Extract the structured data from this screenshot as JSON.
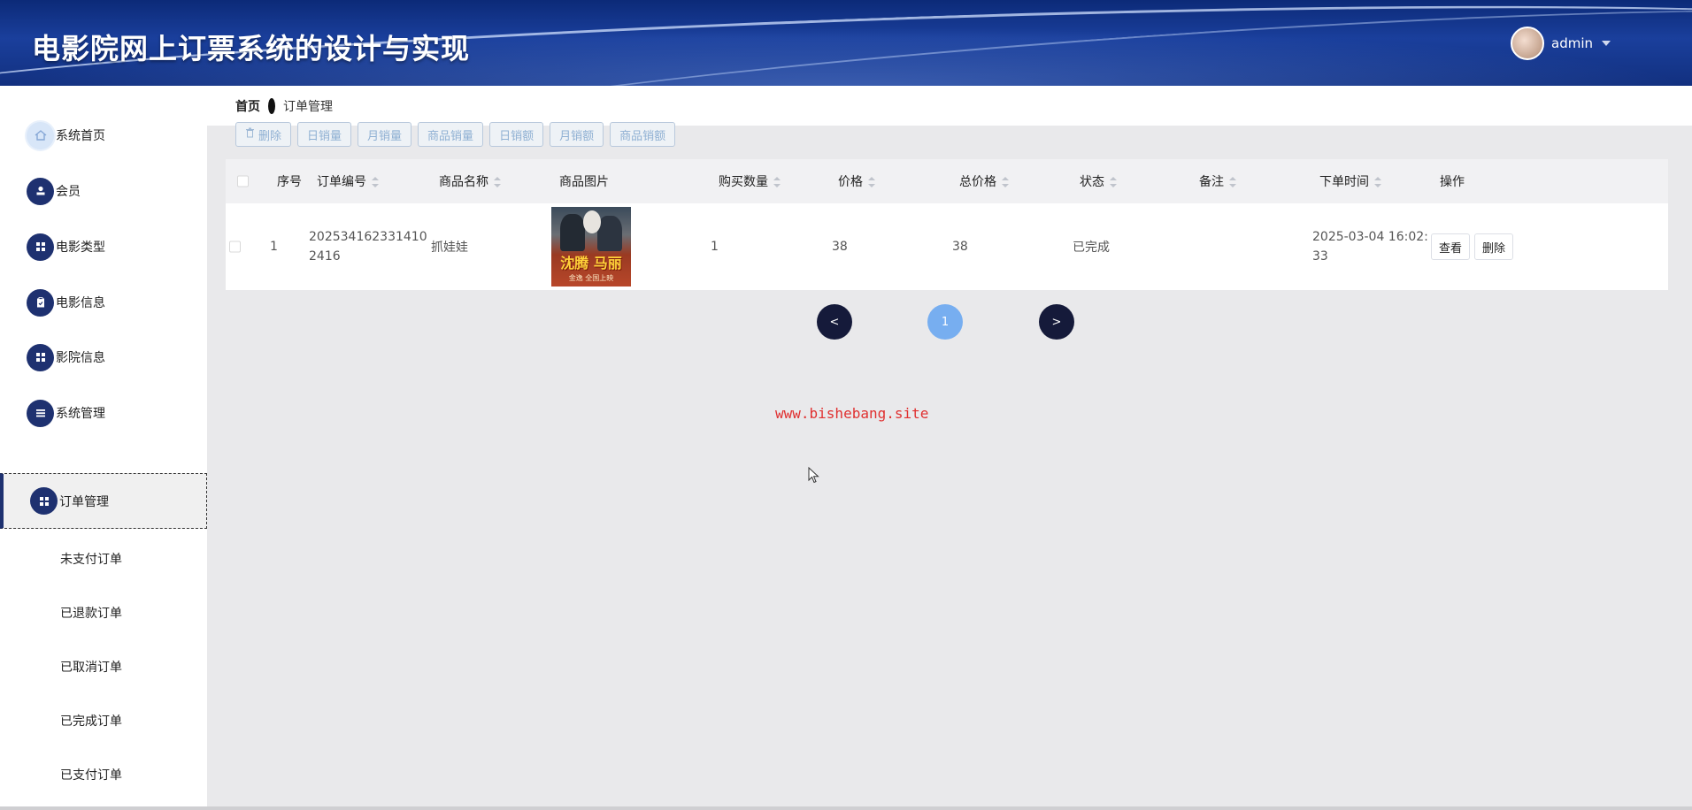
{
  "header": {
    "site_title": "电影院网上订票系统的设计与实现",
    "user_name": "admin"
  },
  "breadcrumb": {
    "home": "首页",
    "current": "订单管理"
  },
  "sidebar": {
    "items": [
      {
        "label": "系统首页",
        "icon": "home-icon"
      },
      {
        "label": "会员",
        "icon": "user-icon"
      },
      {
        "label": "电影类型",
        "icon": "grid-icon"
      },
      {
        "label": "电影信息",
        "icon": "clipboard-icon"
      },
      {
        "label": "影院信息",
        "icon": "grid-icon"
      },
      {
        "label": "系统管理",
        "icon": "list-icon"
      },
      {
        "label": "订单管理",
        "icon": "grid-icon",
        "active": true
      }
    ],
    "sub_items": [
      "未支付订单",
      "已退款订单",
      "已取消订单",
      "已完成订单",
      "已支付订单"
    ]
  },
  "toolbar": {
    "buttons": [
      "删除",
      "日销量",
      "月销量",
      "商品销量",
      "日销额",
      "月销额",
      "商品销额"
    ]
  },
  "table": {
    "columns": [
      "序号",
      "订单编号",
      "商品名称",
      "商品图片",
      "购买数量",
      "价格",
      "总价格",
      "状态",
      "备注",
      "下单时间",
      "操作"
    ],
    "rows": [
      {
        "index": "1",
        "order_no_line1": "202534162331410",
        "order_no_line2": "2416",
        "product_name": "抓娃娃",
        "poster_title": "沈腾 马丽",
        "poster_footer": "金逸 全国上映",
        "quantity": "1",
        "price": "38",
        "total": "38",
        "status": "已完成",
        "remark": "",
        "time_line1": "2025-03-04 16:02:",
        "time_line2": "33",
        "actions": [
          "查看",
          "删除"
        ]
      }
    ]
  },
  "pagination": {
    "prev": "<",
    "current": "1",
    "next": ">"
  },
  "watermark": "www.bishebang.site",
  "colors": {
    "header_bg": "#12307f",
    "sidebar_icon": "#1e3170",
    "content_bg": "#e9e9eb",
    "pager_dark": "#151a3a",
    "pager_current": "#77aef0",
    "watermark": "#e03030"
  }
}
